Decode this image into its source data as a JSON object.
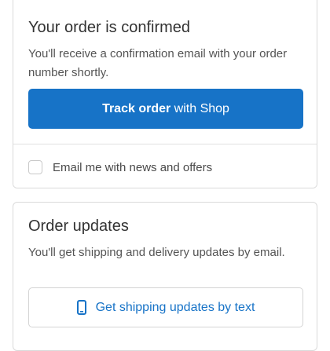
{
  "confirm_card": {
    "title": "Your order is confirmed",
    "description": "You'll receive a confirmation email with your order number shortly.",
    "track_button": {
      "bold": "Track order",
      "rest": "with Shop"
    },
    "newsletter_label": "Email me with news and offers"
  },
  "updates_card": {
    "title": "Order updates",
    "description": "You'll get shipping and delivery updates by email.",
    "sms_button_label": "Get shipping updates by text"
  },
  "colors": {
    "accent": "#1773c7",
    "border": "#dadada",
    "text": "#333333",
    "muted_text": "#545454"
  },
  "icons": {
    "sms_button": "phone-icon"
  }
}
